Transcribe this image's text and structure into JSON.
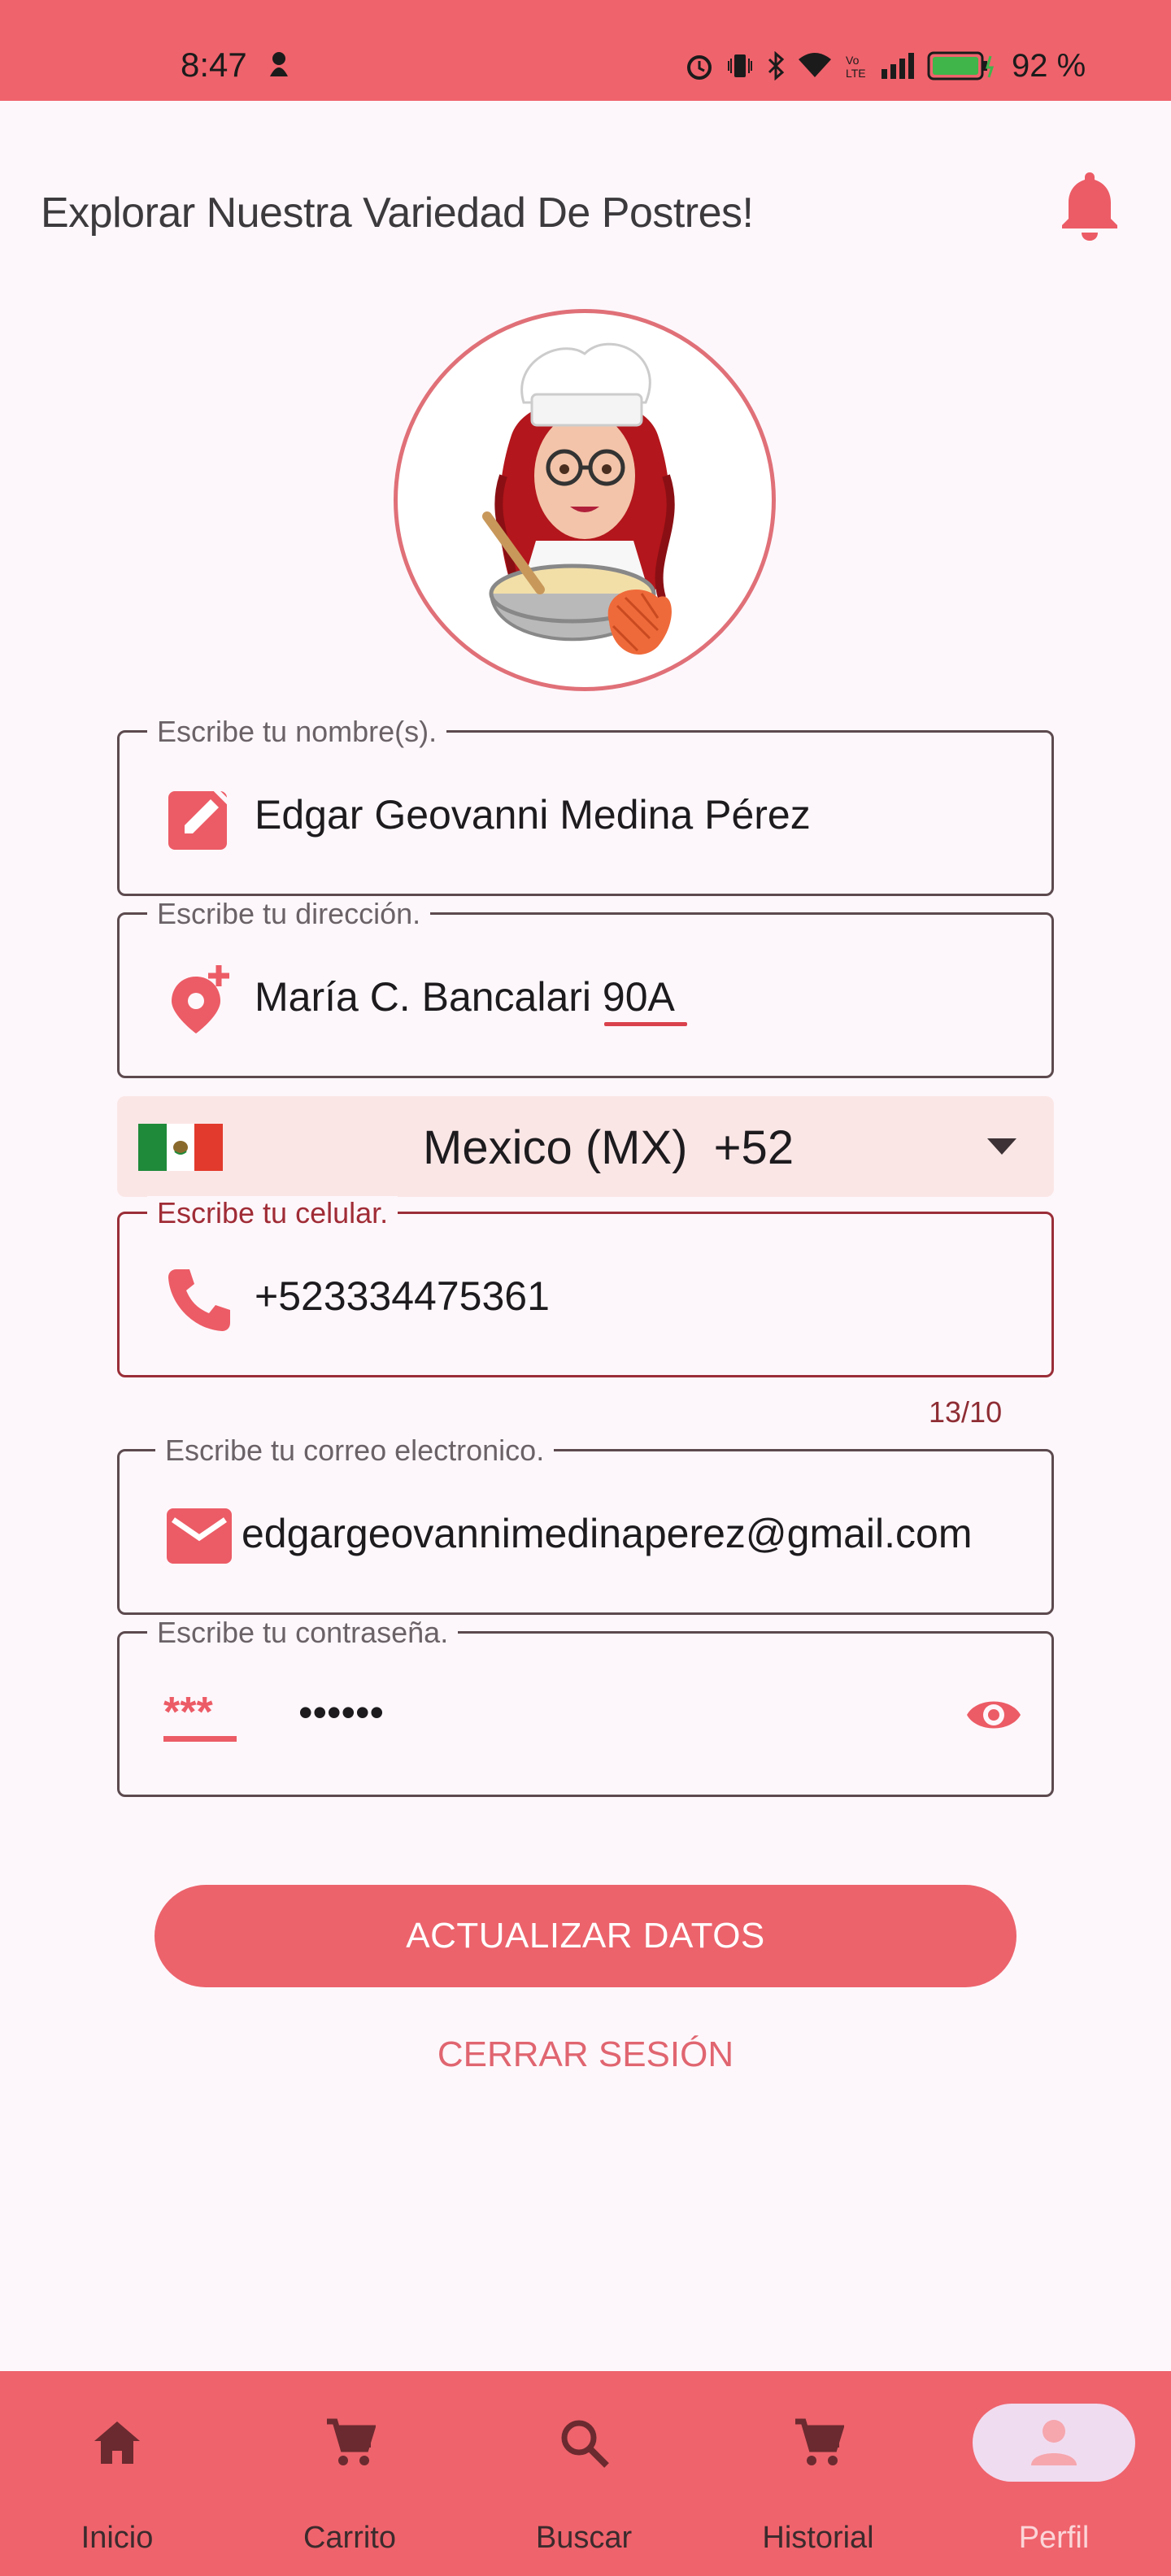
{
  "status_bar": {
    "time": "8:47",
    "battery": "92 %",
    "icons": [
      "alarm-icon",
      "vibrate-icon",
      "bluetooth-icon",
      "wifi-icon",
      "volte-icon",
      "signal-icon",
      "battery-icon"
    ]
  },
  "header": {
    "title": "Explorar Nuestra Variedad De Postres!",
    "bell_icon": "bell-icon"
  },
  "avatar": {
    "description_icon": "chef-avatar"
  },
  "form": {
    "name": {
      "label": "Escribe tu nombre(s).",
      "value": "Edgar Geovanni Medina Pérez",
      "icon": "edit-icon"
    },
    "address": {
      "label": "Escribe tu dirección.",
      "value": "María C. Bancalari 90A",
      "icon": "add-location-icon"
    },
    "country": {
      "value": "Mexico (MX)  +52",
      "flag": "mexico-flag"
    },
    "phone": {
      "label": "Escribe tu celular.",
      "value": "+523334475361",
      "counter": "13/10",
      "icon": "phone-icon"
    },
    "email": {
      "label": "Escribe tu correo electronico.",
      "value": "edgargeovannimedinaperez@gmail.com",
      "icon": "mail-icon"
    },
    "password": {
      "label": "Escribe tu contraseña.",
      "value": "••••••",
      "icon": "password-icon",
      "toggle_icon": "eye-icon"
    }
  },
  "actions": {
    "update_label": "ACTUALIZAR DATOS",
    "logout_label": "CERRAR SESIÓN"
  },
  "bottom_nav": {
    "items": [
      {
        "label": "Inicio",
        "icon": "home-icon"
      },
      {
        "label": "Carrito",
        "icon": "cart-icon"
      },
      {
        "label": "Buscar",
        "icon": "search-icon"
      },
      {
        "label": "Historial",
        "icon": "cart-icon"
      },
      {
        "label": "Perfil",
        "icon": "person-icon"
      }
    ],
    "active": "Perfil"
  },
  "colors": {
    "accent": "#ef636c",
    "background": "#fdf7fb",
    "icon_red": "#ec5c66",
    "error_red": "#9a2e38"
  }
}
